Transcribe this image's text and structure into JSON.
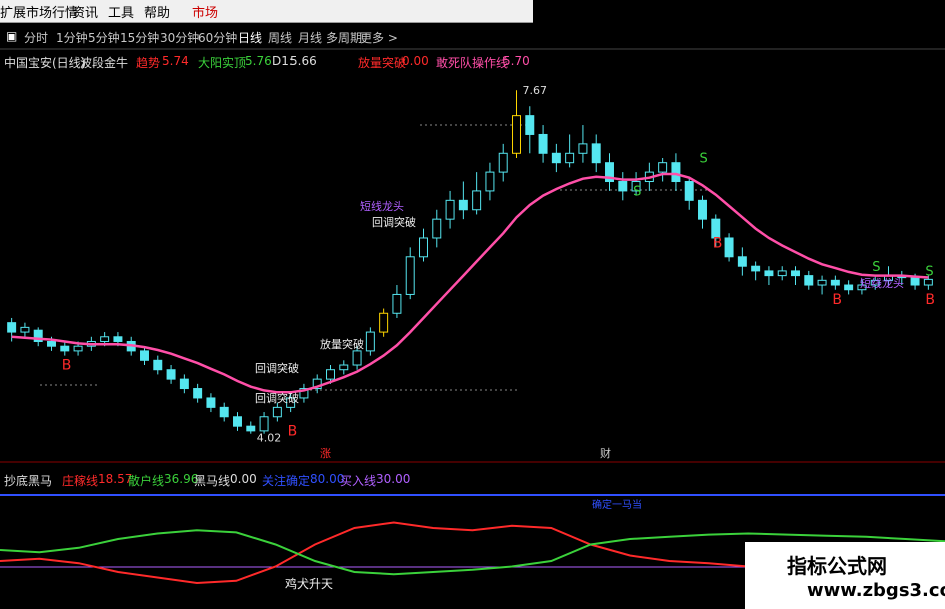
{
  "menu": {
    "items": [
      "扩展市场行情",
      "资讯",
      "工具",
      "帮助",
      "市场"
    ]
  },
  "toolbar": {
    "periods": [
      "分时",
      "1分钟",
      "5分钟",
      "15分钟",
      "30分钟",
      "60分钟",
      "日线",
      "周线",
      "月线",
      "多周期",
      "更多 >"
    ]
  },
  "main_header": {
    "stock": "中国宝安(日线)",
    "indicator": "波段金牛",
    "trend_label": "趋势",
    "trend_value": "5.74",
    "yang_label": "大阳实顶",
    "yang_value": "5.76",
    "d1_label": "D1:",
    "d1_value": "5.66",
    "vol_label": "放量突破",
    "vol_value": "0.00",
    "death_label": "敢死队操作线",
    "death_value": "5.70"
  },
  "sub_header": {
    "name": "抄底黑马",
    "zhuang_label": "庄稼线",
    "zhuang_value": "18.57",
    "san_label": "散户线",
    "san_value": "36.96",
    "hm_label": "黑马线",
    "hm_value": "0.00",
    "line4_label": "关注确定",
    "line4_value": "80.00",
    "buy_label": "买入线",
    "buy_value": "30.00"
  },
  "annotations": {
    "high": "7.67",
    "low": "4.02",
    "zhang": "涨",
    "cai": "财",
    "b": "B",
    "s": "S",
    "huijing1": "回调突破",
    "huijing2": "回调突破",
    "huijing3": "回调突破",
    "fangliang": "放量突破",
    "duanxian1": "短线龙头",
    "duanxian2": "短线龙头",
    "jiquan": "鸡犬升天",
    "queding": "确定一马当"
  },
  "watermark": {
    "line1": "指标公式网",
    "line2": "www.zbgs3.com"
  },
  "colors": {
    "up": "#55e6f0",
    "yellow": "#ffd700",
    "ma": "#ff4fa8",
    "red": "#ff2a2a",
    "green": "#3bd13b",
    "blue": "#3050ff",
    "purple": "#b060ff"
  },
  "chart_data": {
    "type": "line",
    "price_range": [
      4.02,
      7.67
    ],
    "candles": [
      [
        5.2,
        5.1,
        5.25,
        5.0
      ],
      [
        5.1,
        5.15,
        5.2,
        5.05
      ],
      [
        5.12,
        5.0,
        5.15,
        4.95
      ],
      [
        5.0,
        4.95,
        5.05,
        4.9
      ],
      [
        4.95,
        4.9,
        5.0,
        4.85
      ],
      [
        4.9,
        4.95,
        5.0,
        4.85
      ],
      [
        4.95,
        5.0,
        5.05,
        4.9
      ],
      [
        5.0,
        5.05,
        5.1,
        4.95
      ],
      [
        5.05,
        5.0,
        5.1,
        4.95
      ],
      [
        5.0,
        4.9,
        5.05,
        4.85
      ],
      [
        4.9,
        4.8,
        4.95,
        4.75
      ],
      [
        4.8,
        4.7,
        4.85,
        4.65
      ],
      [
        4.7,
        4.6,
        4.75,
        4.55
      ],
      [
        4.6,
        4.5,
        4.65,
        4.45
      ],
      [
        4.5,
        4.4,
        4.55,
        4.35
      ],
      [
        4.4,
        4.3,
        4.45,
        4.25
      ],
      [
        4.3,
        4.2,
        4.35,
        4.15
      ],
      [
        4.2,
        4.1,
        4.25,
        4.05
      ],
      [
        4.1,
        4.05,
        4.15,
        4.02
      ],
      [
        4.05,
        4.2,
        4.25,
        4.02
      ],
      [
        4.2,
        4.3,
        4.35,
        4.15
      ],
      [
        4.3,
        4.4,
        4.45,
        4.25
      ],
      [
        4.4,
        4.5,
        4.55,
        4.35
      ],
      [
        4.5,
        4.6,
        4.65,
        4.45
      ],
      [
        4.6,
        4.7,
        4.75,
        4.55
      ],
      [
        4.7,
        4.75,
        4.8,
        4.65
      ],
      [
        4.75,
        4.9,
        4.95,
        4.7
      ],
      [
        4.9,
        5.1,
        5.15,
        4.85
      ],
      [
        5.1,
        5.3,
        5.35,
        5.05
      ],
      [
        5.3,
        5.5,
        5.6,
        5.25
      ],
      [
        5.5,
        5.9,
        6.0,
        5.45
      ],
      [
        5.9,
        6.1,
        6.2,
        5.85
      ],
      [
        6.1,
        6.3,
        6.4,
        6.0
      ],
      [
        6.3,
        6.5,
        6.6,
        6.2
      ],
      [
        6.5,
        6.4,
        6.7,
        6.3
      ],
      [
        6.4,
        6.6,
        6.8,
        6.35
      ],
      [
        6.6,
        6.8,
        6.9,
        6.5
      ],
      [
        6.8,
        7.0,
        7.1,
        6.7
      ],
      [
        7.0,
        7.4,
        7.67,
        6.95
      ],
      [
        7.4,
        7.2,
        7.5,
        7.0
      ],
      [
        7.2,
        7.0,
        7.3,
        6.9
      ],
      [
        7.0,
        6.9,
        7.1,
        6.8
      ],
      [
        6.9,
        7.0,
        7.2,
        6.85
      ],
      [
        7.0,
        7.1,
        7.3,
        6.9
      ],
      [
        7.1,
        6.9,
        7.2,
        6.8
      ],
      [
        6.9,
        6.7,
        7.0,
        6.6
      ],
      [
        6.7,
        6.6,
        6.8,
        6.5
      ],
      [
        6.6,
        6.7,
        6.8,
        6.55
      ],
      [
        6.7,
        6.8,
        6.9,
        6.6
      ],
      [
        6.8,
        6.9,
        6.95,
        6.7
      ],
      [
        6.9,
        6.7,
        7.0,
        6.6
      ],
      [
        6.7,
        6.5,
        6.75,
        6.4
      ],
      [
        6.5,
        6.3,
        6.55,
        6.2
      ],
      [
        6.3,
        6.1,
        6.35,
        6.0
      ],
      [
        6.1,
        5.9,
        6.15,
        5.85
      ],
      [
        5.9,
        5.8,
        6.0,
        5.7
      ],
      [
        5.8,
        5.75,
        5.85,
        5.65
      ],
      [
        5.75,
        5.7,
        5.8,
        5.6
      ],
      [
        5.7,
        5.75,
        5.8,
        5.65
      ],
      [
        5.75,
        5.7,
        5.8,
        5.6
      ],
      [
        5.7,
        5.6,
        5.75,
        5.55
      ],
      [
        5.6,
        5.65,
        5.7,
        5.5
      ],
      [
        5.65,
        5.6,
        5.7,
        5.55
      ],
      [
        5.6,
        5.55,
        5.65,
        5.5
      ],
      [
        5.55,
        5.6,
        5.65,
        5.5
      ],
      [
        5.6,
        5.65,
        5.7,
        5.55
      ],
      [
        5.65,
        5.7,
        5.8,
        5.6
      ],
      [
        5.7,
        5.68,
        5.75,
        5.6
      ],
      [
        5.68,
        5.6,
        5.72,
        5.55
      ],
      [
        5.6,
        5.66,
        5.7,
        5.55
      ]
    ],
    "ma": [
      5.05,
      5.04,
      5.03,
      5.02,
      5.0,
      4.98,
      4.97,
      4.97,
      4.97,
      4.96,
      4.94,
      4.91,
      4.87,
      4.82,
      4.77,
      4.71,
      4.65,
      4.58,
      4.52,
      4.48,
      4.46,
      4.46,
      4.48,
      4.52,
      4.57,
      4.62,
      4.68,
      4.76,
      4.85,
      4.96,
      5.1,
      5.25,
      5.4,
      5.55,
      5.7,
      5.85,
      6.0,
      6.15,
      6.32,
      6.45,
      6.55,
      6.62,
      6.68,
      6.73,
      6.75,
      6.74,
      6.72,
      6.72,
      6.74,
      6.78,
      6.78,
      6.74,
      6.66,
      6.56,
      6.44,
      6.32,
      6.2,
      6.1,
      6.02,
      5.95,
      5.88,
      5.82,
      5.78,
      5.74,
      5.71,
      5.7,
      5.7,
      5.7,
      5.69,
      5.68
    ],
    "sub_series": [
      {
        "name": "庄稼线",
        "values": [
          40,
          42,
          38,
          30,
          25,
          20,
          22,
          35,
          55,
          70,
          75,
          70,
          68,
          72,
          70,
          55,
          45,
          40,
          38,
          35,
          33,
          32,
          34,
          36,
          40
        ]
      },
      {
        "name": "散户线",
        "values": [
          50,
          48,
          52,
          60,
          65,
          68,
          66,
          55,
          40,
          30,
          28,
          30,
          32,
          35,
          40,
          55,
          60,
          62,
          64,
          65,
          64,
          63,
          62,
          60,
          58
        ]
      }
    ],
    "sub_range": [
      0,
      100
    ]
  }
}
